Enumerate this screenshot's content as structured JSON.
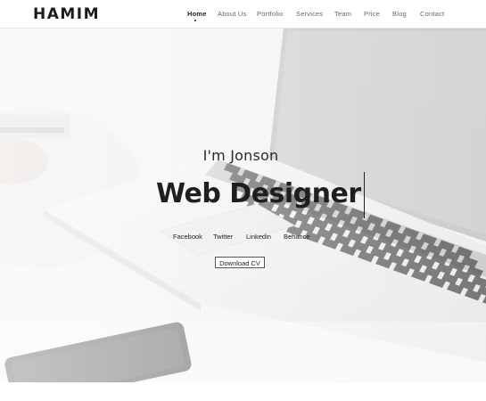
{
  "brand": {
    "logo": "HAMIM"
  },
  "nav": {
    "items": [
      {
        "label": "Home",
        "active": true
      },
      {
        "label": "About Us"
      },
      {
        "label": "Portfolio"
      },
      {
        "label": "Services"
      },
      {
        "label": "Team"
      },
      {
        "label": "Price"
      },
      {
        "label": "Blog"
      },
      {
        "label": "Contact"
      }
    ]
  },
  "hero": {
    "intro": "I'm Jonson",
    "role": "Web Designer",
    "background_image": "laptop-on-desk-photo",
    "social": [
      {
        "label": "Facebook",
        "icon": "facebook"
      },
      {
        "label": "Twitter",
        "icon": "twitter"
      },
      {
        "label": "Linkedin",
        "icon": "linkedin"
      },
      {
        "label": "Behance",
        "icon": "behance"
      }
    ],
    "cta_label": "Download CV"
  },
  "colors": {
    "text": "#222222",
    "header_bg": "#ffffff",
    "hero_bg": "#f4f4f4"
  }
}
